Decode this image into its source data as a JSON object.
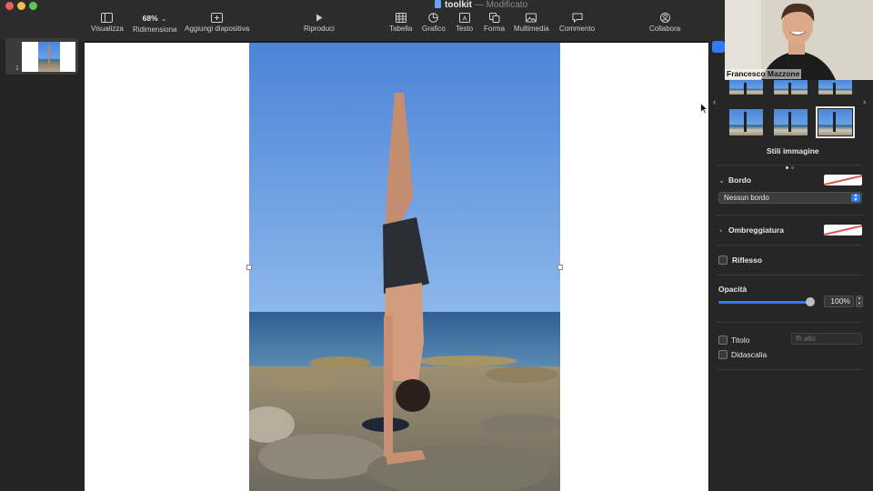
{
  "window": {
    "doc_name": "toolkit",
    "separator": "—",
    "status": "Modificato"
  },
  "toolbar": {
    "view_label": "Visualizza",
    "zoom_value": "68%",
    "zoom_label": "Ridimensiona",
    "add_slide_label": "Aggiungi diapositiva",
    "play_label": "Riproduci",
    "table_label": "Tabella",
    "chart_label": "Grafico",
    "text_label": "Testo",
    "shape_label": "Forma",
    "media_label": "Multimedia",
    "comment_label": "Commento",
    "collaborate_label": "Collabora"
  },
  "navigator": {
    "slides": [
      {
        "number": "1"
      }
    ]
  },
  "webcam": {
    "name": "Francesco Mazzone"
  },
  "inspector": {
    "image_styles_label": "Stili immagine",
    "border_label": "Bordo",
    "border_style": "Nessun bordo",
    "shadow_label": "Ombreggiatura",
    "reflection_label": "Riflesso",
    "opacity_label": "Opacità",
    "opacity_value": "100%",
    "opacity_level": 1.0,
    "title_label": "Titolo",
    "title_position": "In alto",
    "caption_label": "Didascalia",
    "accent_color": "#2f7cf6"
  },
  "icons": {
    "view": "sidebar-icon",
    "add_slide": "add-slide-icon",
    "play": "play-icon",
    "table": "table-icon",
    "chart": "chart-icon",
    "text": "text-box-icon",
    "shape": "shape-icon",
    "media": "media-icon",
    "comment": "comment-icon",
    "collaborate": "collaborate-icon"
  }
}
